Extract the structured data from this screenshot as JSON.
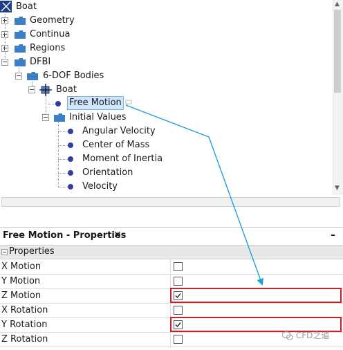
{
  "tree": {
    "root": "Boat",
    "items": [
      "Geometry",
      "Continua",
      "Regions",
      "DFBI",
      "6-DOF Bodies",
      "Boat",
      "Free Motion",
      "Initial Values",
      "Angular Velocity",
      "Center of Mass",
      "Moment of Inertia",
      "Orientation",
      "Velocity"
    ]
  },
  "panel": {
    "title": "Free Motion - Properties",
    "close": "✕",
    "minimize": "–",
    "category": "Properties",
    "rows": [
      {
        "label": "X Motion",
        "checked": false
      },
      {
        "label": "Y Motion",
        "checked": false
      },
      {
        "label": "Z Motion",
        "checked": true
      },
      {
        "label": "X Rotation",
        "checked": false
      },
      {
        "label": "Y Rotation",
        "checked": true
      },
      {
        "label": "Z Rotation",
        "checked": false
      }
    ]
  },
  "watermark": "CFD之道",
  "colors": {
    "annotation_arrow": "#1aa3d9",
    "highlight_box": "#c9212a",
    "bullet": "#2f3f9a",
    "selection": "#cfe6fb"
  }
}
